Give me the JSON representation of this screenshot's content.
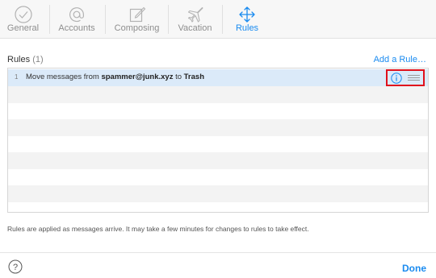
{
  "toolbar": {
    "tabs": [
      {
        "label": "General",
        "icon": "checkmark-circle-icon"
      },
      {
        "label": "Accounts",
        "icon": "at-sign-icon"
      },
      {
        "label": "Composing",
        "icon": "compose-icon"
      },
      {
        "label": "Vacation",
        "icon": "airplane-icon"
      },
      {
        "label": "Rules",
        "icon": "move-arrows-icon"
      }
    ],
    "active_tab": "Rules"
  },
  "rules": {
    "title": "Rules",
    "count": "(1)",
    "add_label": "Add a Rule…",
    "items": [
      {
        "number": "1",
        "prefix": "Move messages from ",
        "sender": "spammer@junk.xyz",
        "middle": " to ",
        "destination": "Trash"
      }
    ],
    "footnote": "Rules are applied as messages arrive. It may take a few minutes for changes to rules to take effect."
  },
  "footer": {
    "help_symbol": "?",
    "done_label": "Done"
  },
  "colors": {
    "accent": "#1a8bf0",
    "selected_row": "#dbeaf9",
    "highlight_box": "#e0101c"
  }
}
